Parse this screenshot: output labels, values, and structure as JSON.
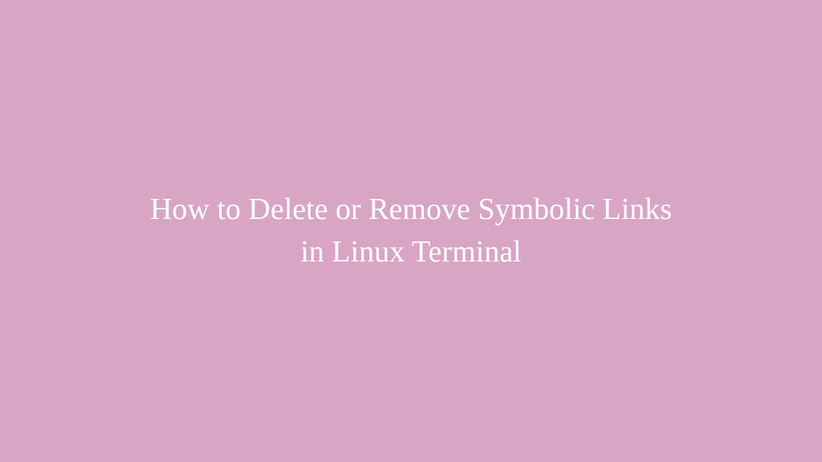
{
  "title": {
    "line1": "How to Delete or Remove Symbolic Links",
    "line2": "in Linux Terminal"
  }
}
